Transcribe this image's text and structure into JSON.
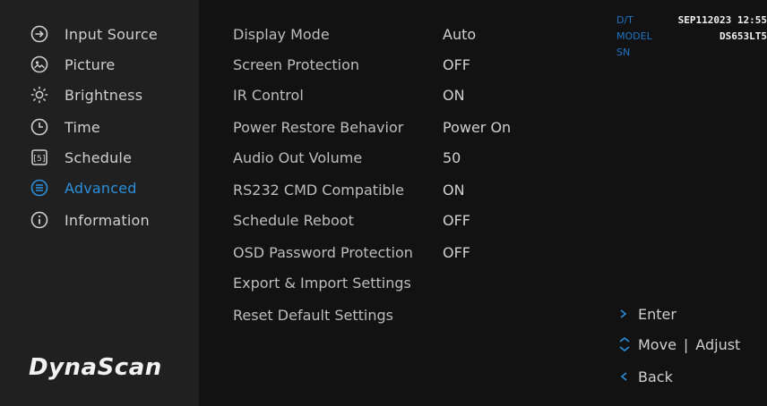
{
  "sidebar": {
    "items": [
      {
        "label": "Input Source",
        "icon": "input-source-icon"
      },
      {
        "label": "Picture",
        "icon": "picture-icon"
      },
      {
        "label": "Brightness",
        "icon": "brightness-icon"
      },
      {
        "label": "Time",
        "icon": "clock-icon"
      },
      {
        "label": "Schedule",
        "icon": "schedule-icon"
      },
      {
        "label": "Advanced",
        "icon": "advanced-icon",
        "active": true
      },
      {
        "label": "Information",
        "icon": "info-icon"
      }
    ],
    "logo": "DynaScan"
  },
  "settings": [
    {
      "label": "Display Mode",
      "value": "Auto"
    },
    {
      "label": "Screen Protection",
      "value": "OFF"
    },
    {
      "label": "IR Control",
      "value": "ON"
    },
    {
      "label": "Power Restore Behavior",
      "value": "Power On"
    },
    {
      "label": "Audio Out Volume",
      "value": "50"
    },
    {
      "label": "RS232 CMD Compatible",
      "value": "ON"
    },
    {
      "label": "Schedule Reboot",
      "value": "OFF"
    },
    {
      "label": "OSD Password Protection",
      "value": "OFF"
    },
    {
      "label": "Export & Import Settings",
      "value": ""
    },
    {
      "label": "Reset Default Settings",
      "value": ""
    }
  ],
  "info": {
    "dt_label": "D/T",
    "dt_value": "SEP112023 12:55",
    "model_label": "MODEL",
    "model_value": "DS653LT5",
    "sn_label": "SN",
    "sn_value": ""
  },
  "hints": {
    "enter": "Enter",
    "move": "Move",
    "sep": "|",
    "adjust": "Adjust",
    "back": "Back"
  },
  "colors": {
    "accent": "#2a8fdc",
    "label_blue": "#1f74c6",
    "sidebar_bg": "#202020",
    "main_bg": "#121212"
  }
}
